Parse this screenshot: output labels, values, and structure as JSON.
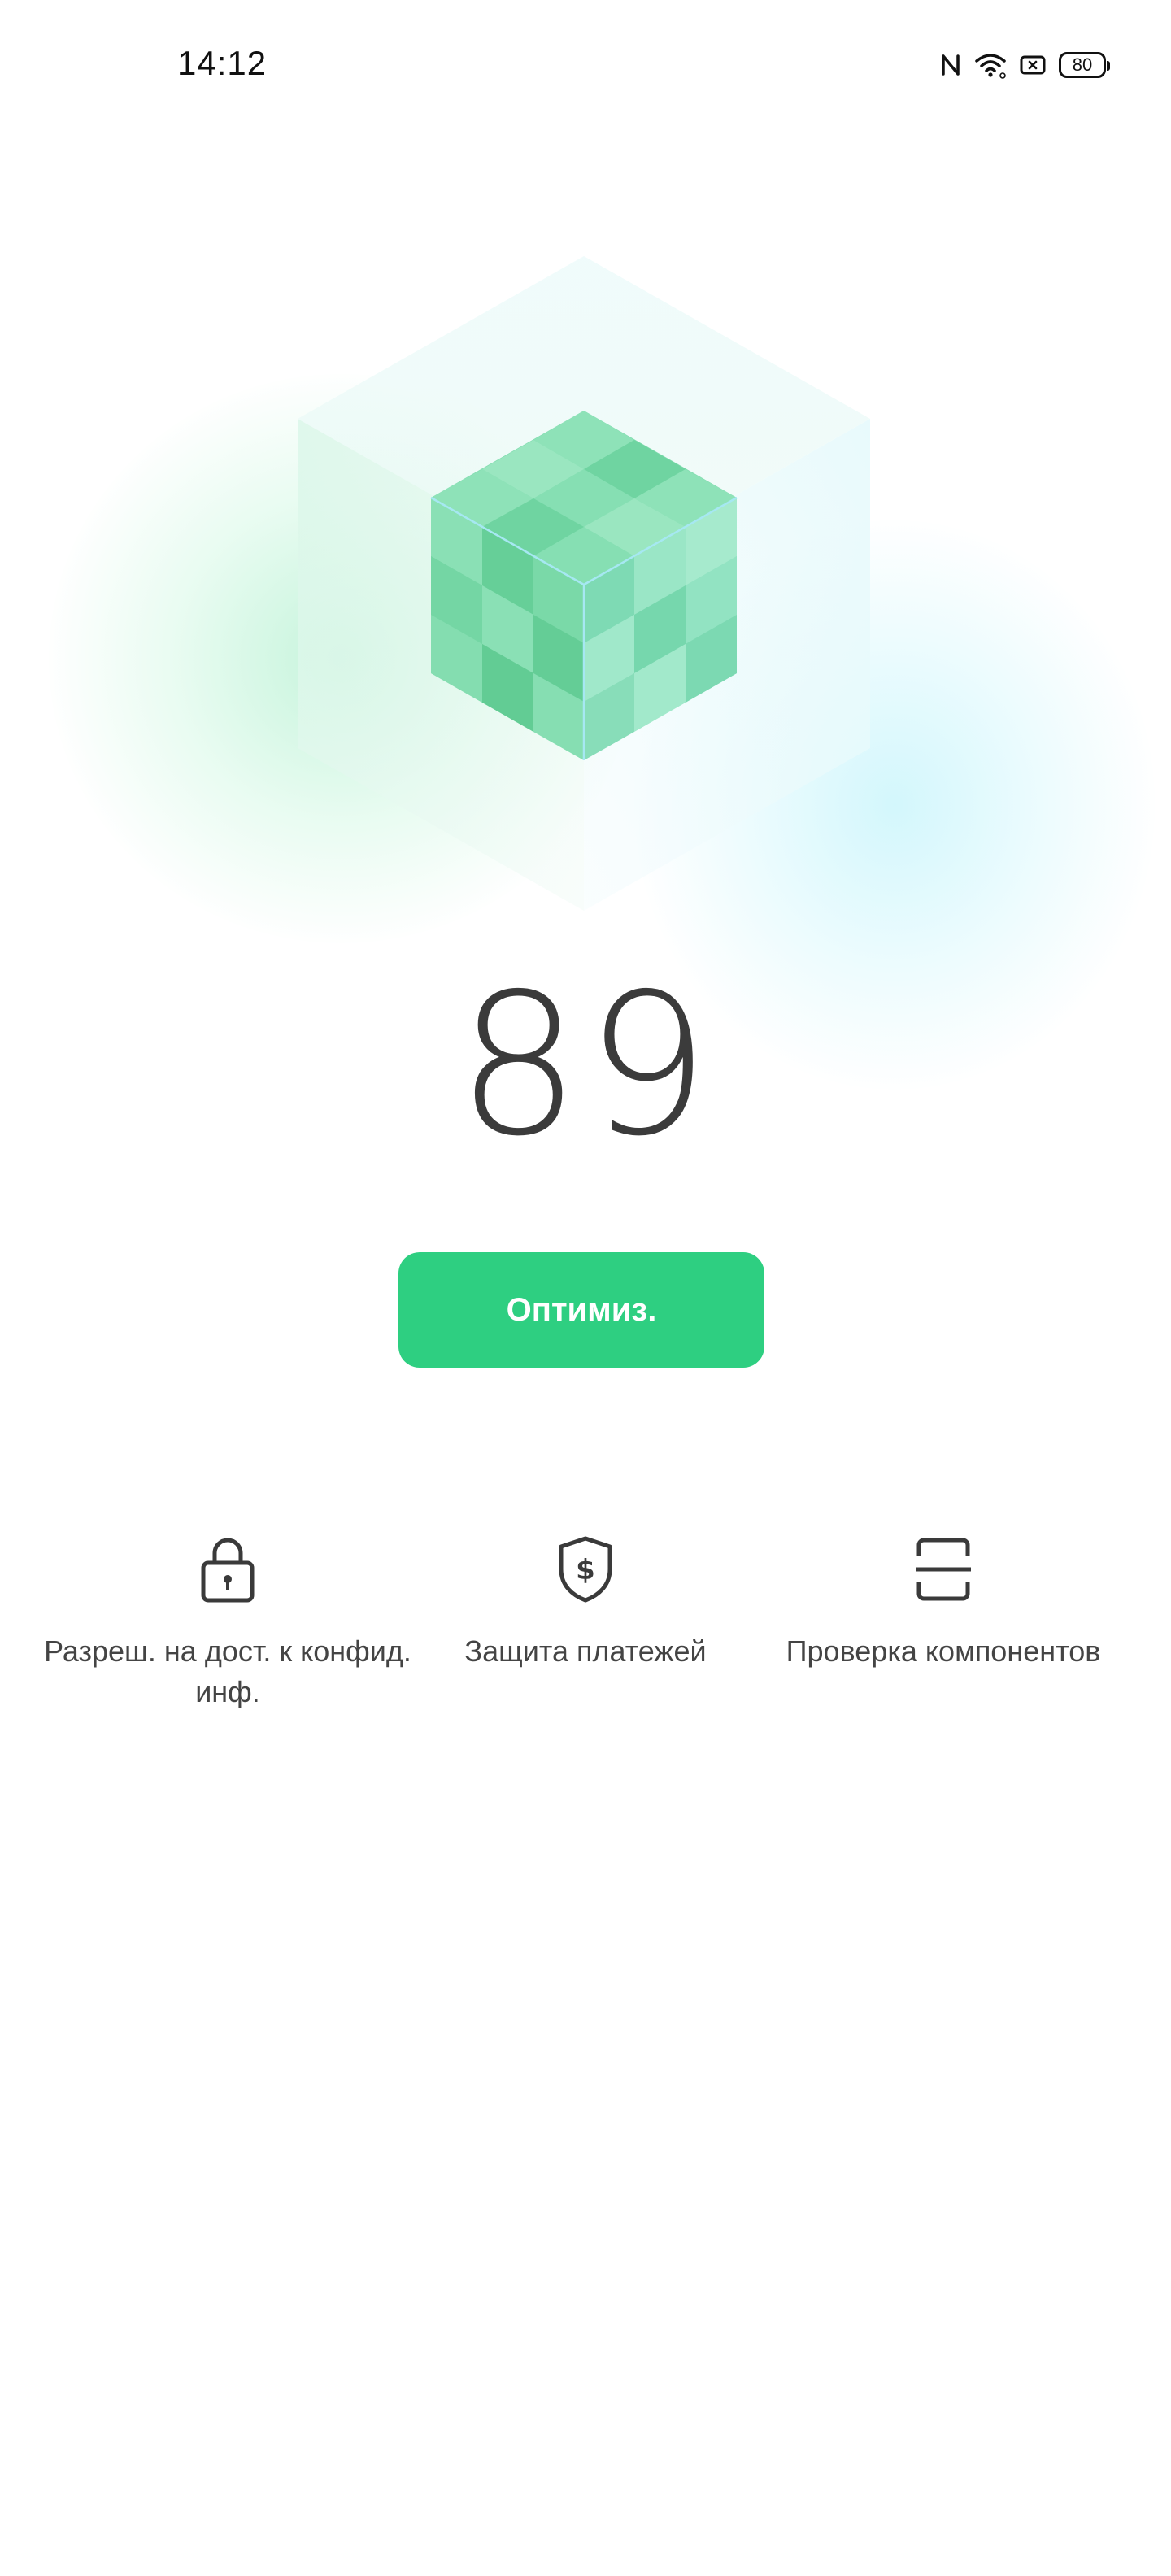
{
  "status_bar": {
    "time": "14:12",
    "battery_level": "80",
    "icons": [
      "nfc-icon",
      "wifi-icon",
      "screen-mirror-icon",
      "battery-icon"
    ]
  },
  "hero": {
    "illustration": "green-cube-icon"
  },
  "score": {
    "value": "89"
  },
  "primary_action": {
    "label": "Оптимиз.",
    "color": "#2ecf81"
  },
  "features": [
    {
      "icon": "lock-icon",
      "label": "Разреш. на дост. к конфид. инф."
    },
    {
      "icon": "shield-dollar-icon",
      "label": "Защита платежей"
    },
    {
      "icon": "scan-icon",
      "label": "Проверка компонентов"
    }
  ]
}
